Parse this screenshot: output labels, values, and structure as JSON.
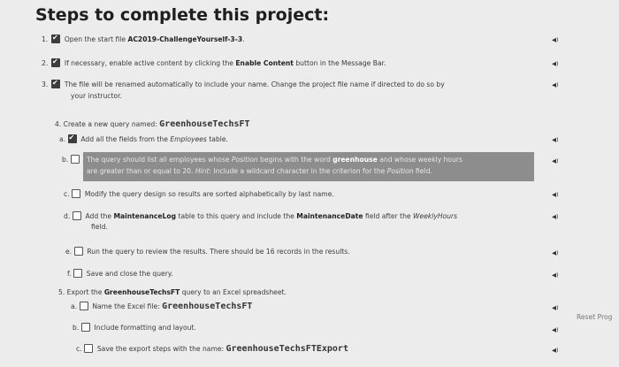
{
  "title": "Steps to complete this project:",
  "steps": {
    "s1": {
      "num": "1.",
      "pre": "Open the start file ",
      "file": "AC2019-ChallengeYourself-3-3",
      "post": "."
    },
    "s2": {
      "num": "2.",
      "pre": "If necessary, enable active content by clicking the ",
      "btn": "Enable Content",
      "post": " button in the Message Bar."
    },
    "s3": {
      "num": "3.",
      "line1": "The file will be renamed automatically to include your name. Change the project file name if directed to do so by",
      "line2": "your instructor."
    },
    "s4": {
      "num": "4.",
      "pre": "Create a new query named: ",
      "name": "GreenhouseTechsFT",
      "a": {
        "label": "a.",
        "pre": "Add all the fields from the ",
        "table": "Employees",
        "post": " table."
      },
      "b": {
        "label": "b.",
        "pre1": "The query should list all employees whose ",
        "field1": "Position",
        "mid1": " begins with the word ",
        "word": "greenhouse",
        "post1": " and whose weekly hours",
        "line2": "are greater than or equal to 20. ",
        "hint": "Hint",
        "mid2": ": Include a wildcard character in the criterion for the ",
        "field2": "Position",
        "post2": " field."
      },
      "c": {
        "label": "c.",
        "text": "Modify the query design so results are sorted alphabetically by last name."
      },
      "d": {
        "label": "d.",
        "pre": "Add the ",
        "table": "MaintenanceLog",
        "mid": " table to this query and include the ",
        "field": "MaintenanceDate",
        "mid2": " field after the ",
        "field2": "WeeklyHours",
        "line2": "field."
      },
      "e": {
        "label": "e.",
        "text": "Run the query to review the results. There should be 16 records in the results."
      },
      "f": {
        "label": "f.",
        "text": "Save and close the query."
      }
    },
    "s5": {
      "num": "5.",
      "pre": "Export the ",
      "query": "GreenhouseTechsFT",
      "post": " query to an Excel spreadsheet.",
      "a": {
        "label": "a.",
        "pre": "Name the Excel file: ",
        "name": "GreenhouseTechsFT"
      },
      "b": {
        "label": "b.",
        "text": "Include formatting and layout."
      },
      "c": {
        "label": "c.",
        "pre": "Save the export steps with the name: ",
        "name": "GreenhouseTechsFTExport"
      }
    }
  },
  "speaker_icon": "◀)",
  "reset_label": "Reset Prog"
}
